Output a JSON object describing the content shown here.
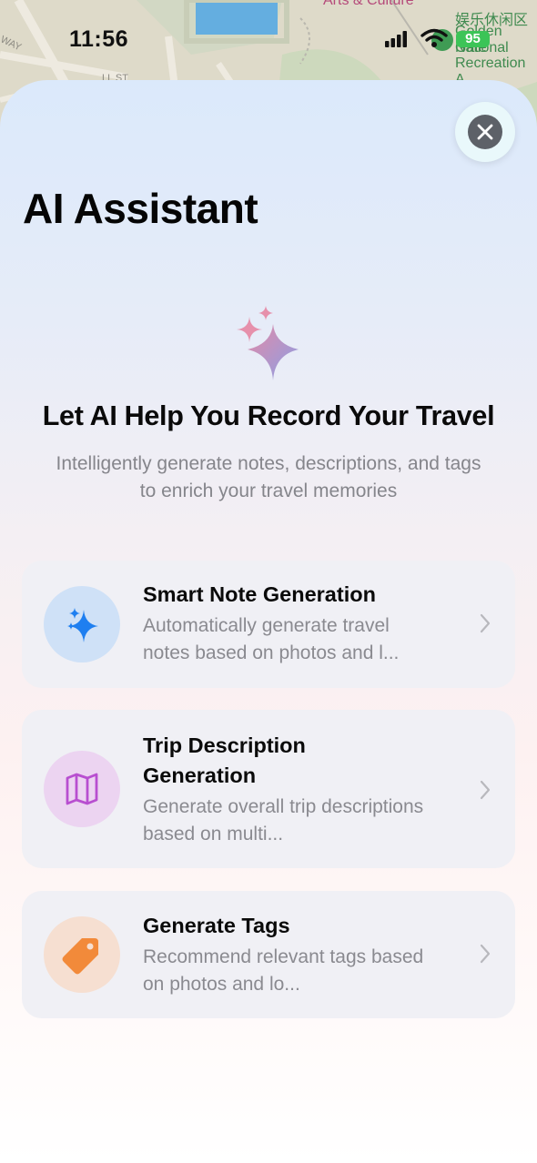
{
  "status_bar": {
    "time": "11:56",
    "battery": "95"
  },
  "map": {
    "labels": {
      "arts": "Arts & Culture",
      "poi_cn": "娱乐休闲区",
      "poi_line1": "Golden Gate",
      "poi_line2": "National",
      "poi_line3": "Recreation A",
      "street_way": "WAY",
      "street_st": "LL ST"
    }
  },
  "sheet": {
    "title": "AI Assistant",
    "hero": {
      "heading": "Let AI Help You Record Your Travel",
      "subtitle": "Intelligently generate notes, descriptions, and tags to enrich your travel memories"
    },
    "features": [
      {
        "title": "Smart Note Generation",
        "description": "Automatically generate travel notes based on photos and l...",
        "icon": "sparkle-icon",
        "color": "#1f7ff0"
      },
      {
        "title": "Trip Description Generation",
        "description": "Generate overall trip descriptions based on multi...",
        "icon": "map-icon",
        "color": "#b84fd0"
      },
      {
        "title": "Generate Tags",
        "description": "Recommend relevant tags based on photos and lo...",
        "icon": "tag-icon",
        "color": "#f28a3a"
      }
    ]
  },
  "colors": {
    "close_button": "#5d6168",
    "battery": "#3cc457",
    "chevron": "#b8b8bd"
  }
}
